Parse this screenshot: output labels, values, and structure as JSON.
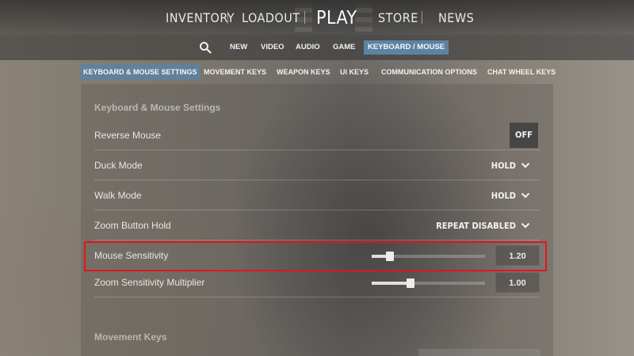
{
  "topnav": {
    "inventory": "INVENTORY",
    "loadout": "LOADOUT",
    "play": "PLAY",
    "store": "STORE",
    "news": "NEWS"
  },
  "settings_tabs": {
    "search_icon": "search-icon",
    "items": [
      "NEW",
      "VIDEO",
      "AUDIO",
      "GAME",
      "KEYBOARD / MOUSE"
    ],
    "active": "KEYBOARD / MOUSE"
  },
  "categories": {
    "items": [
      "KEYBOARD & MOUSE SETTINGS",
      "MOVEMENT KEYS",
      "WEAPON KEYS",
      "UI KEYS",
      "COMMUNICATION OPTIONS",
      "CHAT WHEEL KEYS"
    ],
    "active": "KEYBOARD & MOUSE SETTINGS"
  },
  "section1": {
    "title": "Keyboard & Mouse Settings",
    "rows": {
      "reverse_mouse": {
        "label": "Reverse Mouse",
        "value": "OFF"
      },
      "duck_mode": {
        "label": "Duck Mode",
        "value": "HOLD"
      },
      "walk_mode": {
        "label": "Walk Mode",
        "value": "HOLD"
      },
      "zoom_button_hold": {
        "label": "Zoom Button Hold",
        "value": "REPEAT DISABLED"
      },
      "mouse_sensitivity": {
        "label": "Mouse Sensitivity",
        "value": "1.20",
        "slider_fraction": 0.16
      },
      "zoom_sensitivity": {
        "label": "Zoom Sensitivity Multiplier",
        "value": "1.00",
        "slider_fraction": 0.34
      }
    }
  },
  "section2": {
    "title": "Movement Keys"
  },
  "colors": {
    "accent": "#5c83a1",
    "highlight": "#e0161b"
  }
}
